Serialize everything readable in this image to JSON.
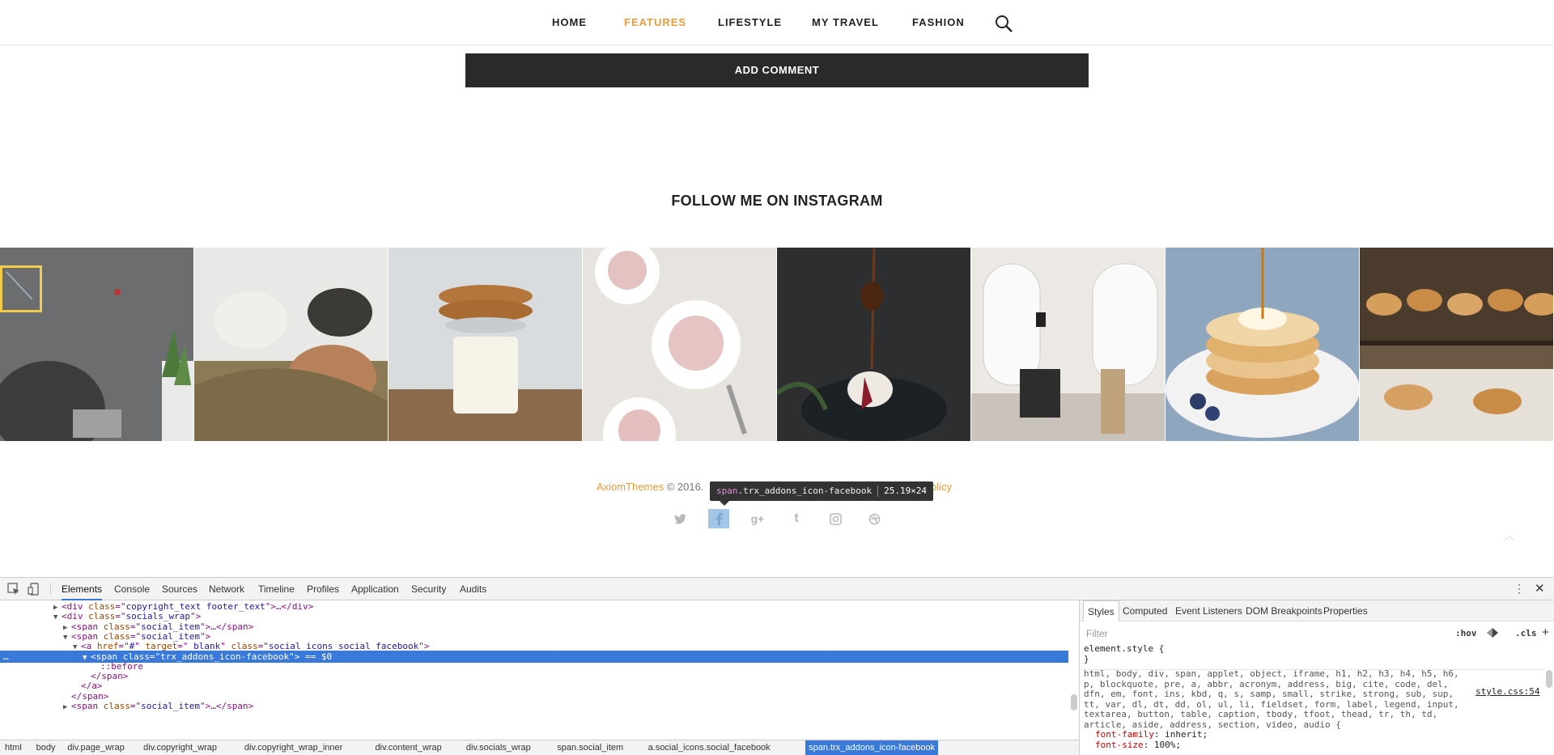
{
  "nav": {
    "items": [
      "HOME",
      "FEATURES",
      "LIFESTYLE",
      "MY TRAVEL",
      "FASHION"
    ],
    "active": "FEATURES"
  },
  "comment": {
    "button_label": "ADD COMMENT"
  },
  "instagram": {
    "title": "FOLLOW ME ON INSTAGRAM"
  },
  "footer": {
    "brand": "AxiomThemes",
    "copyright": " © 2016.",
    "tail": "olicy"
  },
  "tooltip": {
    "tag": "span",
    "class": ".trx_addons_icon-facebook",
    "size": "25.19×24"
  },
  "devtools": {
    "tabs": [
      "Elements",
      "Console",
      "Sources",
      "Network",
      "Timeline",
      "Profiles",
      "Application",
      "Security",
      "Audits"
    ],
    "dom_lines": [
      {
        "indent": 5,
        "arrow": "▶",
        "parts": [
          [
            "p",
            "<"
          ],
          [
            "t",
            "div"
          ],
          [
            "a",
            " class"
          ],
          [
            "p",
            "=\""
          ],
          [
            "v",
            "copyright_text footer_text"
          ],
          [
            "p",
            "\">…</"
          ],
          [
            "t",
            "div"
          ],
          [
            "p",
            ">"
          ]
        ]
      },
      {
        "indent": 5,
        "arrow": "▼",
        "parts": [
          [
            "p",
            "<"
          ],
          [
            "t",
            "div"
          ],
          [
            "a",
            " class"
          ],
          [
            "p",
            "=\""
          ],
          [
            "v",
            "socials_wrap"
          ],
          [
            "p",
            "\">"
          ]
        ]
      },
      {
        "indent": 6,
        "arrow": "▶",
        "parts": [
          [
            "p",
            "<"
          ],
          [
            "t",
            "span"
          ],
          [
            "a",
            " class"
          ],
          [
            "p",
            "=\""
          ],
          [
            "v",
            "social_item"
          ],
          [
            "p",
            "\">…</"
          ],
          [
            "t",
            "span"
          ],
          [
            "p",
            ">"
          ]
        ]
      },
      {
        "indent": 6,
        "arrow": "▼",
        "parts": [
          [
            "p",
            "<"
          ],
          [
            "t",
            "span"
          ],
          [
            "a",
            " class"
          ],
          [
            "p",
            "=\""
          ],
          [
            "v",
            "social_item"
          ],
          [
            "p",
            "\">"
          ]
        ]
      },
      {
        "indent": 7,
        "arrow": "▼",
        "parts": [
          [
            "p",
            "<"
          ],
          [
            "t",
            "a"
          ],
          [
            "a",
            " href"
          ],
          [
            "p",
            "=\""
          ],
          [
            "v",
            "#"
          ],
          [
            "p",
            "\""
          ],
          [
            "a",
            " target"
          ],
          [
            "p",
            "=\""
          ],
          [
            "v",
            "_blank"
          ],
          [
            "p",
            "\""
          ],
          [
            "a",
            " class"
          ],
          [
            "p",
            "=\""
          ],
          [
            "v",
            "social_icons social_facebook"
          ],
          [
            "p",
            "\">"
          ]
        ]
      },
      {
        "indent": 8,
        "arrow": "▼",
        "sel": true,
        "parts": [
          [
            "p",
            "<"
          ],
          [
            "t",
            "span"
          ],
          [
            "a",
            " class"
          ],
          [
            "p",
            "=\""
          ],
          [
            "v",
            "trx_addons_icon-facebook"
          ],
          [
            "p",
            "\">"
          ],
          [
            "p",
            " == $0"
          ]
        ]
      },
      {
        "indent": 9,
        "arrow": "",
        "parts": [
          [
            "t",
            "::before"
          ]
        ]
      },
      {
        "indent": 8,
        "arrow": "",
        "parts": [
          [
            "p",
            "</"
          ],
          [
            "t",
            "span"
          ],
          [
            "p",
            ">"
          ]
        ]
      },
      {
        "indent": 7,
        "arrow": "",
        "parts": [
          [
            "p",
            "</"
          ],
          [
            "t",
            "a"
          ],
          [
            "p",
            ">"
          ]
        ]
      },
      {
        "indent": 6,
        "arrow": "",
        "parts": [
          [
            "p",
            "</"
          ],
          [
            "t",
            "span"
          ],
          [
            "p",
            ">"
          ]
        ]
      },
      {
        "indent": 6,
        "arrow": "▶",
        "parts": [
          [
            "p",
            "<"
          ],
          [
            "t",
            "span"
          ],
          [
            "a",
            " class"
          ],
          [
            "p",
            "=\""
          ],
          [
            "v",
            "social_item"
          ],
          [
            "p",
            "\">…</"
          ],
          [
            "t",
            "span"
          ],
          [
            "p",
            ">"
          ]
        ]
      }
    ],
    "breadcrumbs": [
      "html",
      "body",
      "div.page_wrap",
      "div.copyright_wrap",
      "div.copyright_wrap_inner",
      "div.content_wrap",
      "div.socials_wrap",
      "span.social_item",
      "a.social_icons.social_facebook",
      "span.trx_addons_icon-facebook"
    ],
    "styles_tabs": [
      "Styles",
      "Computed",
      "Event Listeners",
      "DOM Breakpoints",
      "Properties"
    ],
    "filter_placeholder": "Filter",
    "hov": ":hov",
    "cls": ".cls",
    "rule_element": "element.style {",
    "rule_close": "}",
    "rule_selectors": "html, body, div, span, applet, object, iframe, h1, h2, h3, h4, h5, h6, p, blockquote, pre, a, abbr, acronym, address, big, cite, code, del, dfn, em, font, ins, kbd, q, s, samp, small, strike, strong, sub, sup, tt, var, dl, dt, dd, ol, ul, li, fieldset, form, label, legend, input, textarea, button, table, caption, tbody, tfoot, thead, tr, th, td, article, aside, address, section, video, audio {",
    "rule_source": "style.css:54",
    "prop1_name": "font-family",
    "prop1_value": "inherit;",
    "prop2_name": "font-size",
    "prop2_value": "100%;"
  }
}
